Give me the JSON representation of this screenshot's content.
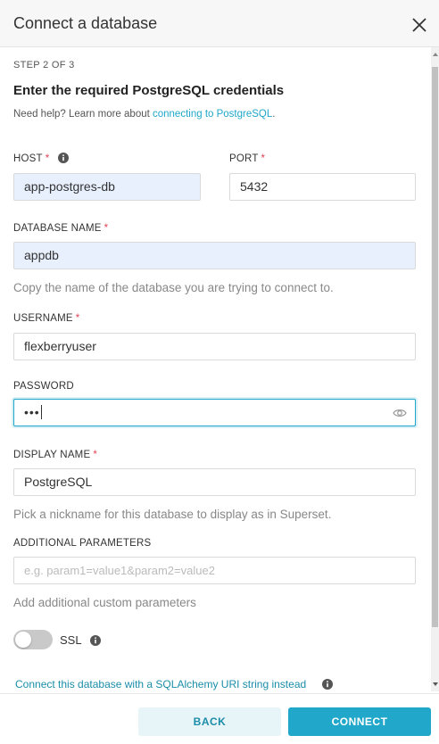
{
  "header": {
    "title": "Connect a database"
  },
  "form": {
    "step": "STEP 2 OF 3",
    "heading": "Enter the required PostgreSQL credentials",
    "help_prefix": "Need help? Learn more about ",
    "help_link": "connecting to PostgreSQL",
    "help_suffix": ".",
    "host": {
      "label": "HOST",
      "value": "app-postgres-db"
    },
    "port": {
      "label": "PORT",
      "value": "5432"
    },
    "database": {
      "label": "DATABASE NAME",
      "value": "appdb",
      "hint": "Copy the name of the database you are trying to connect to."
    },
    "username": {
      "label": "USERNAME",
      "value": "flexberryuser"
    },
    "password": {
      "label": "PASSWORD",
      "value": "•••"
    },
    "display_name": {
      "label": "DISPLAY NAME",
      "value": "PostgreSQL",
      "hint": "Pick a nickname for this database to display as in Superset."
    },
    "additional": {
      "label": "ADDITIONAL PARAMETERS",
      "placeholder": "e.g. param1=value1&param2=value2",
      "hint": "Add additional custom parameters"
    },
    "ssl": {
      "label": "SSL",
      "enabled": false
    },
    "uri_link": "Connect this database with a SQLAlchemy URI string instead",
    "required_mark": "*"
  },
  "footer": {
    "back_label": "BACK",
    "connect_label": "CONNECT"
  },
  "colors": {
    "accent": "#20a7c9",
    "required": "#e04355",
    "autofill": "#e8f0fe"
  }
}
